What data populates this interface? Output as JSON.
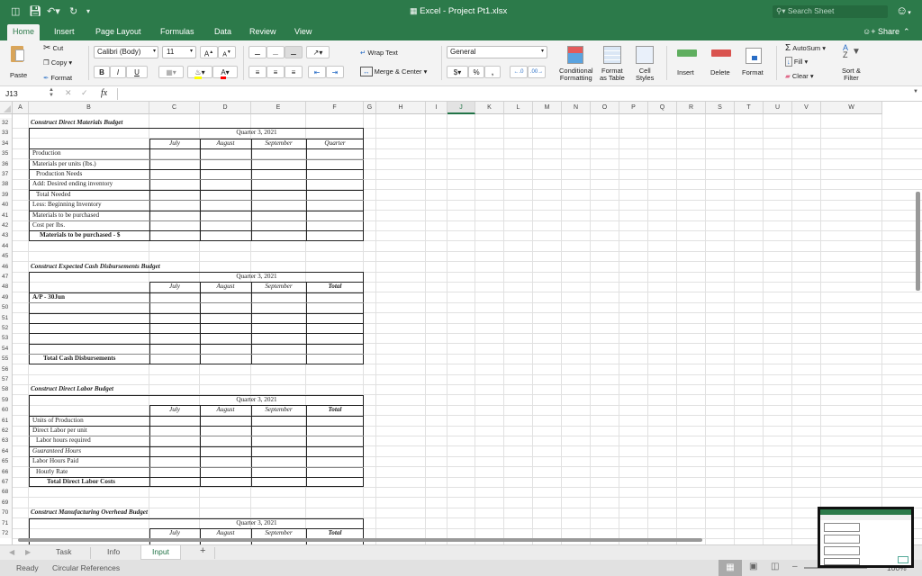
{
  "app": {
    "title": "Excel - Project Pt1.xlsx",
    "search_placeholder": "Search Sheet",
    "share_label": "Share"
  },
  "quick_access": [
    "sidebar-toggle",
    "save",
    "undo",
    "redo",
    "customize"
  ],
  "menu_tabs": [
    {
      "label": "Home",
      "active": true
    },
    {
      "label": "Insert"
    },
    {
      "label": "Page Layout"
    },
    {
      "label": "Formulas"
    },
    {
      "label": "Data"
    },
    {
      "label": "Review"
    },
    {
      "label": "View"
    }
  ],
  "ribbon": {
    "paste": "Paste",
    "cut": "Cut",
    "copy": "Copy",
    "format_painter": "Format",
    "font_name": "Calibri (Body)",
    "font_size": "11",
    "bold": "B",
    "italic": "I",
    "underline": "U",
    "wrap_text": "Wrap Text",
    "merge_center": "Merge & Center",
    "number_format": "General",
    "currency": "$",
    "percent": "%",
    "comma": "’",
    "conditional_formatting": [
      "Conditional",
      "Formatting"
    ],
    "format_as_table": [
      "Format",
      "as Table"
    ],
    "cell_styles": [
      "Cell",
      "Styles"
    ],
    "insert": "Insert",
    "delete": "Delete",
    "format": "Format",
    "autosum": "AutoSum",
    "fill": "Fill",
    "clear": "Clear",
    "sort_filter": [
      "Sort &",
      "Filter"
    ],
    "colors": {
      "fill_color": "#ffff00",
      "font_color": "#ff0000",
      "brand": "#2c7a4a"
    }
  },
  "formula_bar": {
    "name_box": "J13",
    "fx": "fx",
    "value": ""
  },
  "columns": [
    "A",
    "B",
    "C",
    "D",
    "E",
    "F",
    "G",
    "H",
    "I",
    "J",
    "K",
    "L",
    "M",
    "N",
    "O",
    "P",
    "Q",
    "R",
    "S",
    "T",
    "U",
    "V",
    "W"
  ],
  "selected_column": "J",
  "rows": [
    32,
    33,
    34,
    35,
    36,
    37,
    38,
    39,
    40,
    41,
    42,
    43,
    44,
    45,
    46,
    47,
    48,
    49,
    50,
    51,
    52,
    53,
    54,
    55,
    56,
    57,
    58,
    59,
    60,
    61,
    62,
    63,
    64,
    65,
    66,
    67,
    68,
    69,
    70,
    71,
    72
  ],
  "sheet": {
    "materials": {
      "title": "Construct Direct Materials Budget",
      "quarter": "Quarter 3, 2021",
      "months": [
        "July",
        "August",
        "September",
        "Quarter"
      ],
      "lines": [
        "Production",
        "Materials per units (lbs.)",
        "Production Needs",
        "Add: Desired ending inventory",
        "Total Needed",
        "Less: Beginning Inventory",
        "Materials to be purchased",
        "Cost per lbs.",
        "Materials to be purchased - $"
      ]
    },
    "cash": {
      "title": "Construct Expected Cash Disbursements Budget",
      "quarter": "Quarter 3, 2021",
      "months": [
        "July",
        "August",
        "September",
        "Total"
      ],
      "lines": [
        "A/P - 30Jun",
        "",
        "",
        "",
        "",
        "",
        "Total Cash Disbursements"
      ]
    },
    "labor": {
      "title": "Construct Direct Labor Budget",
      "quarter": "Quarter 3, 2021",
      "months": [
        "July",
        "August",
        "September",
        "Total"
      ],
      "lines": [
        "Units of Production",
        "Direct Labor per unit",
        "Labor hours required",
        "Guaranteed Hours",
        "Labor Hours Paid",
        "Hourly Rate",
        "Total Direct Labor Costs"
      ]
    },
    "overhead": {
      "title": "Construct Manufacturing Overhead Budget",
      "quarter": "Quarter 3, 2021",
      "months": [
        "July",
        "August",
        "September",
        "Total"
      ]
    }
  },
  "sheet_tabs": [
    {
      "label": "Task"
    },
    {
      "label": "Info"
    },
    {
      "label": "Input",
      "active": true
    }
  ],
  "add_sheet": "+",
  "status": {
    "ready": "Ready",
    "circular": "Circular References",
    "zoom": "100%"
  }
}
